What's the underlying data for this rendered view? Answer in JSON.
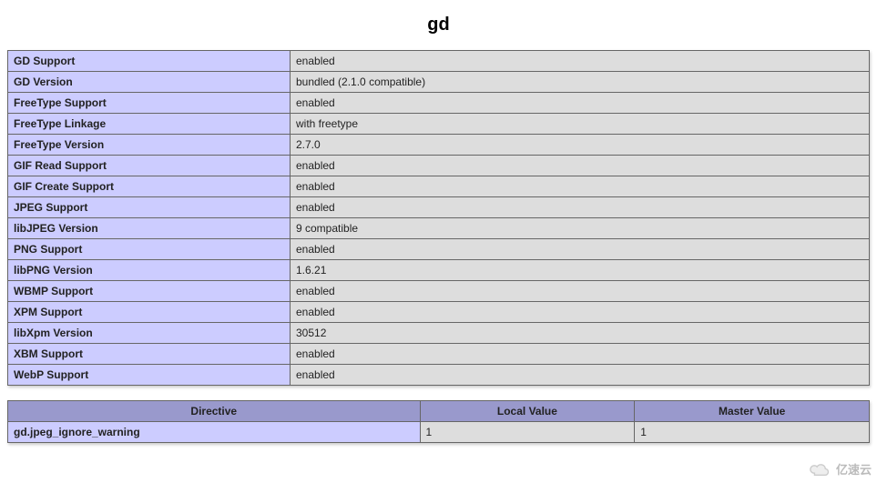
{
  "title": "gd",
  "info": [
    {
      "label": "GD Support",
      "value": "enabled"
    },
    {
      "label": "GD Version",
      "value": "bundled (2.1.0 compatible)"
    },
    {
      "label": "FreeType Support",
      "value": "enabled"
    },
    {
      "label": "FreeType Linkage",
      "value": "with freetype"
    },
    {
      "label": "FreeType Version",
      "value": "2.7.0"
    },
    {
      "label": "GIF Read Support",
      "value": "enabled"
    },
    {
      "label": "GIF Create Support",
      "value": "enabled"
    },
    {
      "label": "JPEG Support",
      "value": "enabled"
    },
    {
      "label": "libJPEG Version",
      "value": "9 compatible"
    },
    {
      "label": "PNG Support",
      "value": "enabled"
    },
    {
      "label": "libPNG Version",
      "value": "1.6.21"
    },
    {
      "label": "WBMP Support",
      "value": "enabled"
    },
    {
      "label": "XPM Support",
      "value": "enabled"
    },
    {
      "label": "libXpm Version",
      "value": "30512"
    },
    {
      "label": "XBM Support",
      "value": "enabled"
    },
    {
      "label": "WebP Support",
      "value": "enabled"
    }
  ],
  "directive_headers": {
    "col1": "Directive",
    "col2": "Local Value",
    "col3": "Master Value"
  },
  "directives": [
    {
      "name": "gd.jpeg_ignore_warning",
      "local": "1",
      "master": "1"
    }
  ],
  "watermark": "亿速云"
}
